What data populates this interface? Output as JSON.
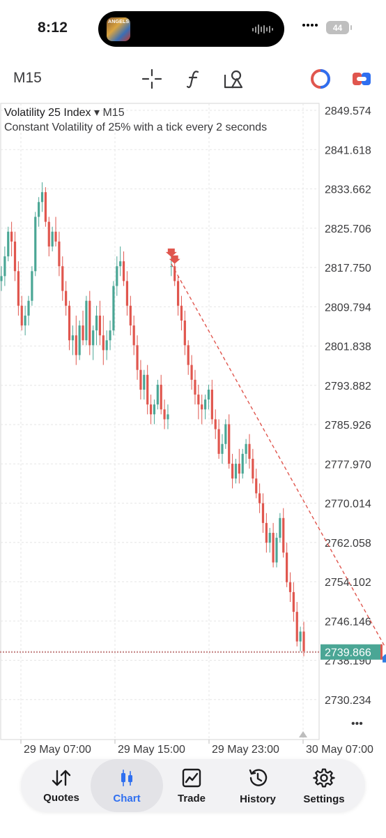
{
  "status": {
    "time": "8:12",
    "battery": "44",
    "island_art_text": "ANGELS"
  },
  "toolbar": {
    "timeframe": "M15",
    "icons": [
      "crosshair-icon",
      "function-icon",
      "objects-icon",
      "one-click-trading-icon",
      "trade-toggle-icon"
    ]
  },
  "chart": {
    "symbol": "Volatility 25 Index",
    "symbol_arrow": "▾",
    "timeframe": "M15",
    "description": "Constant Volatility of 25% with a tick every 2 seconds",
    "current_price": "2739.866",
    "more_label": "•••"
  },
  "chart_data": {
    "type": "candlestick",
    "title": "Volatility 25 Index",
    "y_ticks": [
      2849.574,
      2841.618,
      2833.662,
      2825.706,
      2817.75,
      2809.794,
      2801.838,
      2793.882,
      2785.926,
      2777.97,
      2770.014,
      2762.058,
      2754.102,
      2746.146,
      2738.19,
      2730.234
    ],
    "y_tick_labels": [
      "2849.574",
      "2841.618",
      "2833.662",
      "2825.706",
      "2817.750",
      "2809.794",
      "2801.838",
      "2793.882",
      "2785.926",
      "2777.970",
      "2770.014",
      "2762.058",
      "2754.102",
      "2746.146",
      "2738.190",
      "2730.234"
    ],
    "ylim": [
      2726.0,
      2851.5
    ],
    "x_tick_labels": [
      "29 May 07:00",
      "29 May 15:00",
      "29 May 23:00",
      "30 May 07:00"
    ],
    "current_price": 2739.866,
    "bull_color": "#4aa695",
    "bear_color": "#e0564e",
    "trade_line": {
      "from_price": 2818.5,
      "to_price": 2740.8,
      "from_index": 50,
      "to_index": 113,
      "color": "#e0564e",
      "dash": true
    },
    "markers": [
      {
        "kind": "sell-arrow",
        "index": 50,
        "price": 2820.6,
        "color": "#e0564e"
      },
      {
        "kind": "sell-arrow",
        "index": 51,
        "price": 2819.2,
        "color": "#e0564e"
      },
      {
        "kind": "buy-arrow",
        "index": 113,
        "price": 2738.6,
        "color": "#2f7de1"
      }
    ],
    "candles": [
      [
        2815,
        2818,
        2813,
        2816
      ],
      [
        2816,
        2822,
        2814,
        2820
      ],
      [
        2820,
        2826,
        2819,
        2825
      ],
      [
        2825,
        2827,
        2820,
        2823
      ],
      [
        2823,
        2825,
        2815,
        2817
      ],
      [
        2817,
        2819,
        2808,
        2810
      ],
      [
        2810,
        2812,
        2805,
        2806
      ],
      [
        2806,
        2810,
        2804,
        2808
      ],
      [
        2808,
        2812,
        2806,
        2811
      ],
      [
        2811,
        2818,
        2810,
        2817
      ],
      [
        2817,
        2829,
        2816,
        2828
      ],
      [
        2828,
        2832,
        2826,
        2831
      ],
      [
        2831,
        2835,
        2829,
        2833
      ],
      [
        2833,
        2834,
        2826,
        2827
      ],
      [
        2827,
        2828,
        2820,
        2822
      ],
      [
        2822,
        2826,
        2821,
        2825
      ],
      [
        2825,
        2828,
        2822,
        2823
      ],
      [
        2823,
        2825,
        2816,
        2818
      ],
      [
        2818,
        2820,
        2811,
        2813
      ],
      [
        2813,
        2815,
        2808,
        2810
      ],
      [
        2810,
        2811,
        2801,
        2803
      ],
      [
        2803,
        2806,
        2800,
        2804
      ],
      [
        2804,
        2808,
        2798,
        2800
      ],
      [
        2800,
        2807,
        2799,
        2806
      ],
      [
        2806,
        2809,
        2802,
        2803
      ],
      [
        2803,
        2812,
        2802,
        2811
      ],
      [
        2811,
        2813,
        2800,
        2802
      ],
      [
        2802,
        2806,
        2799,
        2805
      ],
      [
        2805,
        2810,
        2802,
        2808
      ],
      [
        2808,
        2811,
        2802,
        2804
      ],
      [
        2804,
        2808,
        2798,
        2801
      ],
      [
        2801,
        2805,
        2799,
        2803
      ],
      [
        2803,
        2807,
        2801,
        2805
      ],
      [
        2805,
        2815,
        2804,
        2814
      ],
      [
        2814,
        2820,
        2812,
        2818
      ],
      [
        2818,
        2822,
        2816,
        2819
      ],
      [
        2819,
        2821,
        2814,
        2815
      ],
      [
        2815,
        2817,
        2808,
        2810
      ],
      [
        2810,
        2812,
        2804,
        2806
      ],
      [
        2806,
        2808,
        2800,
        2802
      ],
      [
        2802,
        2804,
        2795,
        2797
      ],
      [
        2797,
        2799,
        2791,
        2793
      ],
      [
        2793,
        2797,
        2791,
        2796
      ],
      [
        2796,
        2798,
        2788,
        2790
      ],
      [
        2790,
        2792,
        2786,
        2788
      ],
      [
        2788,
        2791,
        2786,
        2790
      ],
      [
        2790,
        2795,
        2789,
        2794
      ],
      [
        2794,
        2796,
        2788,
        2789
      ],
      [
        2789,
        2791,
        2785,
        2787
      ],
      [
        2787,
        2790,
        2785,
        2788
      ],
      [
        2818,
        2820,
        2816,
        2818
      ],
      [
        2818,
        2819,
        2814,
        2815
      ],
      [
        2815,
        2816,
        2808,
        2810
      ],
      [
        2810,
        2812,
        2805,
        2807
      ],
      [
        2807,
        2809,
        2800,
        2802
      ],
      [
        2802,
        2803,
        2796,
        2798
      ],
      [
        2798,
        2800,
        2793,
        2795
      ],
      [
        2795,
        2797,
        2790,
        2792
      ],
      [
        2792,
        2794,
        2787,
        2790
      ],
      [
        2790,
        2792,
        2786,
        2789
      ],
      [
        2789,
        2792,
        2787,
        2791
      ],
      [
        2791,
        2794,
        2789,
        2793
      ],
      [
        2793,
        2795,
        2786,
        2787
      ],
      [
        2787,
        2789,
        2783,
        2785
      ],
      [
        2785,
        2787,
        2779,
        2780
      ],
      [
        2780,
        2784,
        2778,
        2782
      ],
      [
        2782,
        2787,
        2781,
        2786
      ],
      [
        2786,
        2788,
        2777,
        2778
      ],
      [
        2778,
        2780,
        2773,
        2775
      ],
      [
        2775,
        2779,
        2774,
        2778
      ],
      [
        2778,
        2781,
        2774,
        2776
      ],
      [
        2776,
        2781,
        2775,
        2780
      ],
      [
        2780,
        2783,
        2778,
        2782
      ],
      [
        2782,
        2784,
        2777,
        2779
      ],
      [
        2779,
        2781,
        2774,
        2775
      ],
      [
        2775,
        2777,
        2771,
        2772
      ],
      [
        2772,
        2774,
        2768,
        2770
      ],
      [
        2770,
        2772,
        2764,
        2766
      ],
      [
        2766,
        2768,
        2760,
        2762
      ],
      [
        2762,
        2765,
        2760,
        2764
      ],
      [
        2764,
        2766,
        2757,
        2758
      ],
      [
        2758,
        2764,
        2757,
        2763
      ],
      [
        2763,
        2768,
        2762,
        2767
      ],
      [
        2767,
        2769,
        2759,
        2760
      ],
      [
        2760,
        2762,
        2753,
        2754
      ],
      [
        2754,
        2756,
        2750,
        2752
      ],
      [
        2752,
        2754,
        2746,
        2748
      ],
      [
        2748,
        2750,
        2741,
        2742
      ],
      [
        2742,
        2745,
        2740,
        2744
      ],
      [
        2744,
        2746,
        2739,
        2740
      ]
    ]
  },
  "nav": {
    "items": [
      {
        "label": "Quotes",
        "icon": "sort-arrows-icon"
      },
      {
        "label": "Chart",
        "icon": "candles-icon"
      },
      {
        "label": "Trade",
        "icon": "trade-chart-icon"
      },
      {
        "label": "History",
        "icon": "history-clock-icon"
      },
      {
        "label": "Settings",
        "icon": "gear-icon"
      }
    ],
    "active": "Chart"
  }
}
